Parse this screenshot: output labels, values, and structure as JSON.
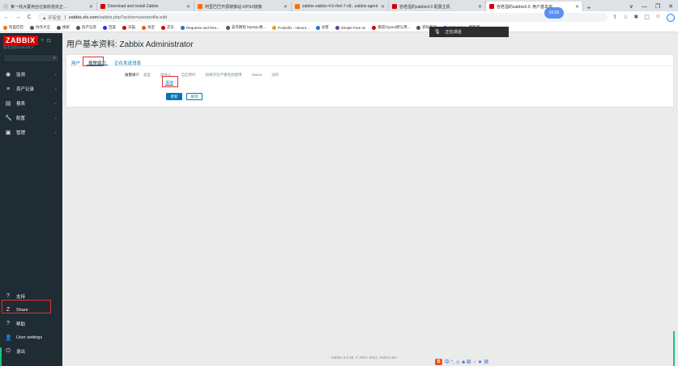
{
  "browser": {
    "tabs": [
      {
        "label": "某一线大厦用丝垃圾收拾完正...",
        "color": "#c9c9c9",
        "active": false
      },
      {
        "label": "Download and install Zabbix",
        "color": "#d40000",
        "active": false
      },
      {
        "label": "阿里巴巴开源镜像站-OPSX镜像",
        "color": "#ff6a00",
        "active": false
      },
      {
        "label": "zabbix-zabbix-4.0-rhel-7-x8...zabbix-agent",
        "color": "#ff6a00",
        "active": false
      },
      {
        "label": "容老湿的zabbix4.0 配置主机",
        "color": "#d40000",
        "active": false
      },
      {
        "label": "容老湿的zabbix5.0: 用户基本资",
        "color": "#d40000",
        "active": true
      }
    ],
    "new_tab": "+",
    "window_controls": [
      "∨",
      "—",
      "❐",
      "✕"
    ],
    "timer": "03:00",
    "url_warning": "▲ 不安全",
    "url_host": "zabbix.zls.com",
    "url_path": "/zabbix.php?action=userprofile.edit",
    "bookmarks": [
      {
        "label": "阿里巴巴",
        "color": "#ff6a00"
      },
      {
        "label": "协作大全",
        "color": "#555"
      },
      {
        "label": "搜索",
        "color": "#555"
      },
      {
        "label": "房产信息",
        "color": "#555"
      },
      {
        "label": "百度",
        "color": "#2932e1"
      },
      {
        "label": "天猫",
        "color": "#d40000"
      },
      {
        "label": "淘宝",
        "color": "#ff5000"
      },
      {
        "label": "京东",
        "color": "#d40000"
      },
      {
        "label": "Requests and Res...",
        "color": "#3367d6"
      },
      {
        "label": "菜鸟教程 MySQL教...",
        "color": "#555"
      },
      {
        "label": "Pointofix - Herunt...",
        "color": "#e8a020"
      },
      {
        "label": "访客",
        "color": "#1a73e8"
      },
      {
        "label": "Simple Free Im",
        "color": "#6b3fa0"
      },
      {
        "label": "看成Typora默认用...",
        "color": "#d40000"
      },
      {
        "label": "新标签页",
        "color": "#555"
      },
      {
        "label": "Sakuraino - 稿酷博...",
        "color": "#7a2bd6"
      }
    ],
    "sharing_label": "正在讲话"
  },
  "sidebar": {
    "logo": "ZABBIX",
    "collapse": "«",
    "server_name": "容老湿的zabbix5.0",
    "search_icon": "⌕",
    "items": [
      {
        "icon": "◉",
        "label": "监测"
      },
      {
        "icon": "≡",
        "label": "资产记录"
      },
      {
        "icon": "▤",
        "label": "报表"
      },
      {
        "icon": "🔧",
        "label": "配置"
      },
      {
        "icon": "▣",
        "label": "管理"
      }
    ],
    "bottom_items": [
      {
        "icon": "?",
        "label": "支持"
      },
      {
        "icon": "Z",
        "label": "Share"
      },
      {
        "icon": "?",
        "label": "帮助"
      },
      {
        "icon": "👤",
        "label": "User settings"
      },
      {
        "icon": "⏻",
        "label": "退出"
      }
    ]
  },
  "main": {
    "title": "用户基本资料: Zabbix Administrator",
    "tabs": [
      {
        "label": "用户"
      },
      {
        "label": "报警媒介"
      },
      {
        "label": "正在发送消息"
      }
    ],
    "media": {
      "label": "报警媒介",
      "columns": [
        "类型",
        "收件人",
        "当启用时",
        "如果存在严重性则使用",
        "Status",
        "动作"
      ],
      "add_link": "添加"
    },
    "buttons": {
      "update": "更新",
      "cancel": "取消"
    },
    "footer": "Zabbix 5.0.26. © 2001–2022, Zabbix SIA"
  },
  "ime_label": "中 °, ☺ ♣ ▦ ♂ ▼ ▦"
}
